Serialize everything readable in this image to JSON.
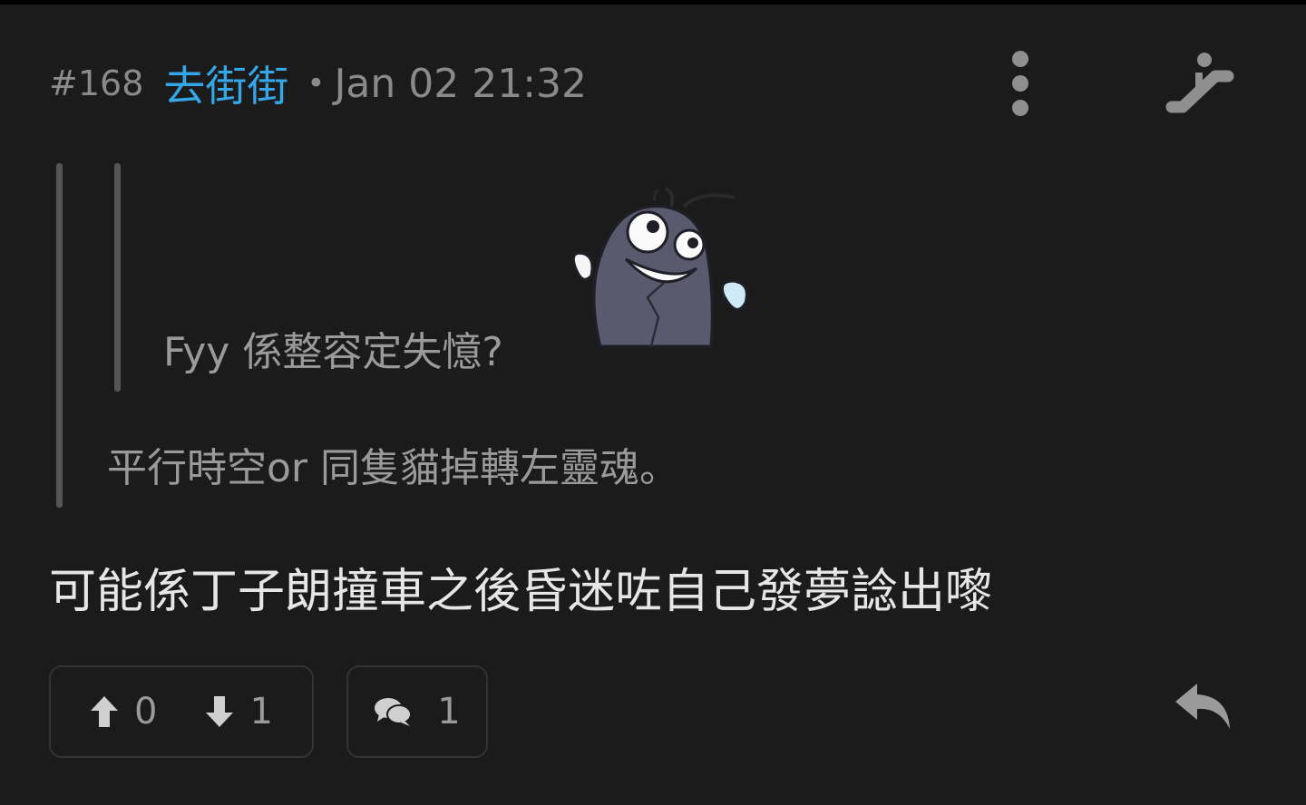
{
  "post": {
    "number": "#168",
    "username": "去街街",
    "separator": "•",
    "timestamp": "Jan 02 21:32",
    "quote_inner": "Fyy 係整容定失憶?",
    "quote_outer": "平行時空or 同隻貓掉轉左靈魂。",
    "body": "可能係丁子朗撞車之後昏迷咗自己發夢諗出嚟"
  },
  "actions": {
    "upvotes": "0",
    "downvotes": "1",
    "comments": "1"
  },
  "icons": {
    "more": "more-vertical-icon",
    "escalator": "escalator-icon",
    "upvote": "arrow-up-icon",
    "downvote": "arrow-down-icon",
    "comment": "comment-bubbles-icon",
    "reply": "reply-icon"
  },
  "colors": {
    "background": "#1b1b1b",
    "username": "#35a7e8",
    "muted_text": "#8a8a8a",
    "body_text": "#e6e6e6"
  }
}
